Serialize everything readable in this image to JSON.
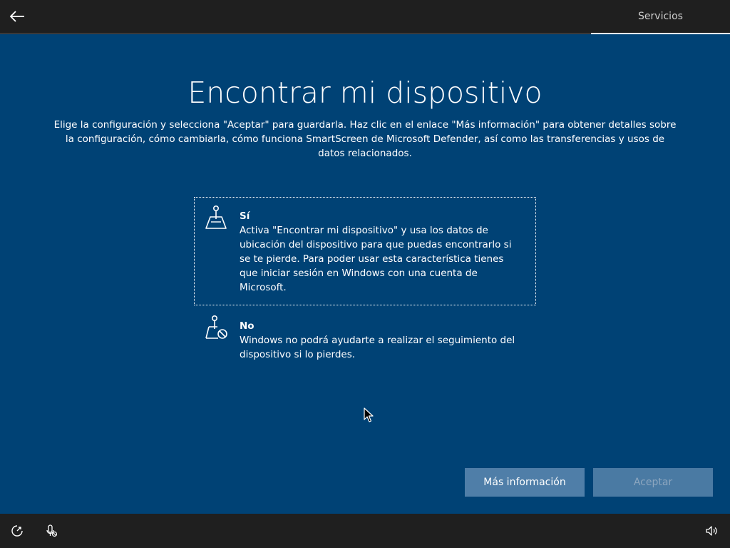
{
  "header": {
    "back_icon": "back-arrow-icon",
    "tab_label": "Servicios"
  },
  "main": {
    "title": "Encontrar mi dispositivo",
    "description": "Elige la configuración y selecciona \"Aceptar\" para guardarla. Haz clic en el enlace \"Más información\" para obtener detalles sobre la configuración, cómo cambiarla, cómo funciona SmartScreen de Microsoft Defender, así como las transferencias y usos de datos relacionados.",
    "options": [
      {
        "label": "Sí",
        "description": "Activa \"Encontrar mi dispositivo\" y usa los datos de ubicación del dispositivo para que puedas encontrarlo si se te pierde. Para poder usar esta característica tienes que iniciar sesión en Windows con una cuenta de Microsoft.",
        "icon": "map-pin-icon",
        "selected": true
      },
      {
        "label": "No",
        "description": "Windows no podrá ayudarte a realizar el seguimiento del dispositivo si lo pierdes.",
        "icon": "map-pin-blocked-icon",
        "selected": false
      }
    ]
  },
  "buttons": {
    "more_info": "Más información",
    "accept": "Aceptar",
    "accept_enabled": false
  },
  "bottombar": {
    "left_icons": [
      "ease-of-access-icon",
      "microphone-icon"
    ],
    "right_icons": [
      "volume-icon"
    ]
  },
  "colors": {
    "background": "#004275",
    "bar": "#1f1f1f",
    "button_primary": "#4f7ea8",
    "button_disabled_text": "#8ca6bf"
  }
}
